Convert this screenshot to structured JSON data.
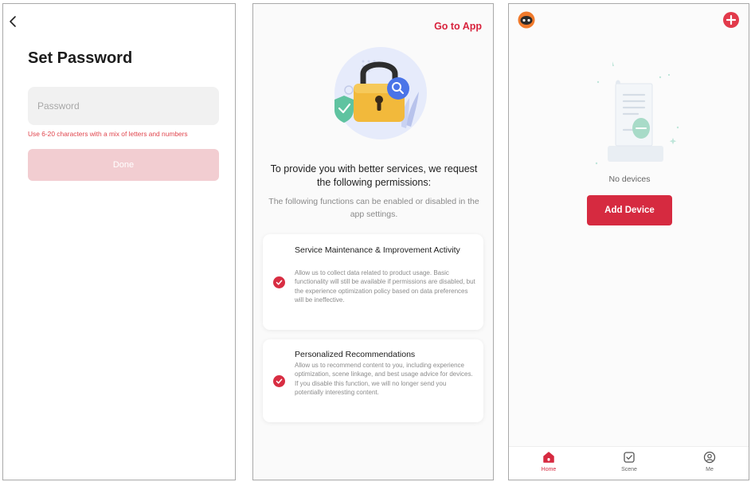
{
  "set_password": {
    "title": "Set Password",
    "password_placeholder": "Password",
    "hint": "Use 6-20 characters with a mix of letters and numbers",
    "done_label": "Done"
  },
  "permissions": {
    "go_to_app": "Go to App",
    "heading": "To provide you with better services, we request the following permissions:",
    "subheading": "The following functions can be enabled or disabled in the app settings.",
    "cards": [
      {
        "title": "Service Maintenance & Improvement Activity",
        "description": "Allow us to collect data related to product usage. Basic functionality will still be available if permissions are disabled, but the experience optimization policy based on data preferences will be ineffective.",
        "checked": true
      },
      {
        "title": "Personalized Recommendations",
        "description": "Allow us to recommend content to you, including experience optimization, scene linkage, and best usage advice for devices. If you disable this function, we will no longer send you potentially interesting content.",
        "checked": true
      }
    ]
  },
  "home": {
    "empty_text": "No devices",
    "add_device_label": "Add Device",
    "tabs": [
      {
        "label": "Home",
        "icon": "home-icon",
        "active": true
      },
      {
        "label": "Scene",
        "icon": "scene-icon",
        "active": false
      },
      {
        "label": "Me",
        "icon": "profile-icon",
        "active": false
      }
    ]
  },
  "colors": {
    "accent": "#d62a40",
    "accent_disabled": "#f2cdd1",
    "hint_red": "#e0454d",
    "lock_gold": "#f2b93b",
    "shield_green": "#5fc3a0",
    "search_blue": "#4a74e8"
  }
}
